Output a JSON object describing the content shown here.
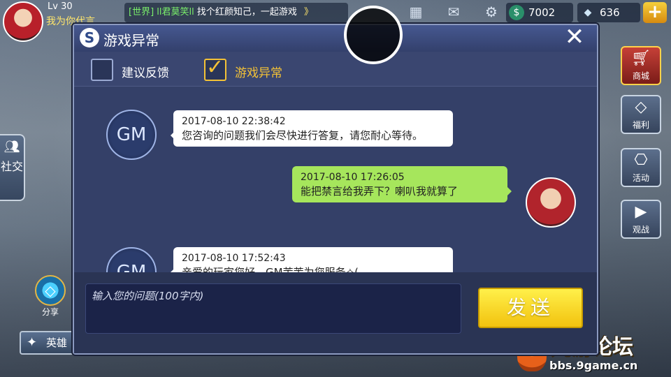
{
  "hud": {
    "level": "Lv 30",
    "player_name": "我为你代言",
    "world_chat": {
      "tag": "[世界]",
      "sender": "ll君莫笑ll",
      "message": "找个红颜知己，一起游戏",
      "more": "》"
    },
    "icons": [
      "calendar-icon",
      "mail-icon",
      "gear-icon"
    ],
    "coins": "7002",
    "diamonds": "636",
    "plus": "+"
  },
  "side_menu": [
    {
      "label": "商城",
      "icon": "cart-icon"
    },
    {
      "label": "福利",
      "icon": "diamond-icon"
    },
    {
      "label": "活动",
      "icon": "gift-icon"
    },
    {
      "label": "观战",
      "icon": "play-icon"
    }
  ],
  "left_menu": {
    "social": "社交",
    "share": "分享",
    "hero": "英雄"
  },
  "watermark": {
    "brand": "九游论坛",
    "url": "bbs.9game.cn"
  },
  "modal": {
    "logo": "S",
    "title": "游戏异常",
    "close": "✕",
    "tabs": [
      {
        "label": "建议反馈",
        "checked": false
      },
      {
        "label": "游戏异常",
        "checked": true
      }
    ],
    "messages": [
      {
        "sender": "GM",
        "timestamp": "2017-08-10 22:38:42",
        "text": "您咨询的问题我们会尽快进行答复，请您耐心等待。"
      },
      {
        "sender": "player",
        "timestamp": "2017-08-10 17:26:05",
        "text": "能把禁言给我弄下？喇叭我就算了"
      },
      {
        "sender": "GM",
        "timestamp": "2017-08-10 17:52:43",
        "text": "亲爱的玩家您好，GM茉茉为您服务✧("
      }
    ],
    "input_placeholder": "输入您的问题(100字内)",
    "send_label": "发送"
  }
}
